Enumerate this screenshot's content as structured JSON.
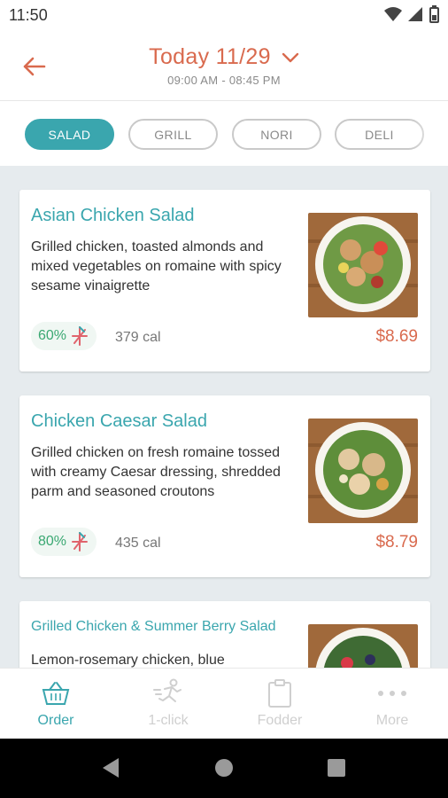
{
  "status_bar": {
    "time": "11:50"
  },
  "header": {
    "title": "Today 11/29",
    "hours": "09:00 AM - 08:45 PM"
  },
  "tabs": [
    {
      "label": "SALAD",
      "active": true
    },
    {
      "label": "GRILL",
      "active": false
    },
    {
      "label": "NORI",
      "active": false
    },
    {
      "label": "DELI",
      "active": false
    }
  ],
  "items": [
    {
      "name": "Asian Chicken Salad",
      "description": "Grilled chicken, toasted almonds and mixed vegetables on romaine with spicy sesame vinaigrette",
      "percent": "60%",
      "calories": "379 cal",
      "price": "$8.69"
    },
    {
      "name": "Chicken Caesar Salad",
      "description": "Grilled chicken on fresh romaine tossed with creamy Caesar dressing, shredded parm and seasoned croutons",
      "percent": "80%",
      "calories": "435 cal",
      "price": "$8.79"
    },
    {
      "name": "Grilled Chicken & Summer Berry Salad",
      "description": "Lemon-rosemary chicken, blue"
    }
  ],
  "bottom_nav": [
    {
      "label": "Order",
      "icon": "basket-icon",
      "active": true
    },
    {
      "label": "1-click",
      "icon": "runner-icon",
      "active": false
    },
    {
      "label": "Fodder",
      "icon": "clipboard-icon",
      "active": false
    },
    {
      "label": "More",
      "icon": "more-dots-icon",
      "active": false
    }
  ],
  "colors": {
    "accent": "#3aa6ae",
    "price": "#d96a4e",
    "feed_bg": "#e6ebee"
  }
}
